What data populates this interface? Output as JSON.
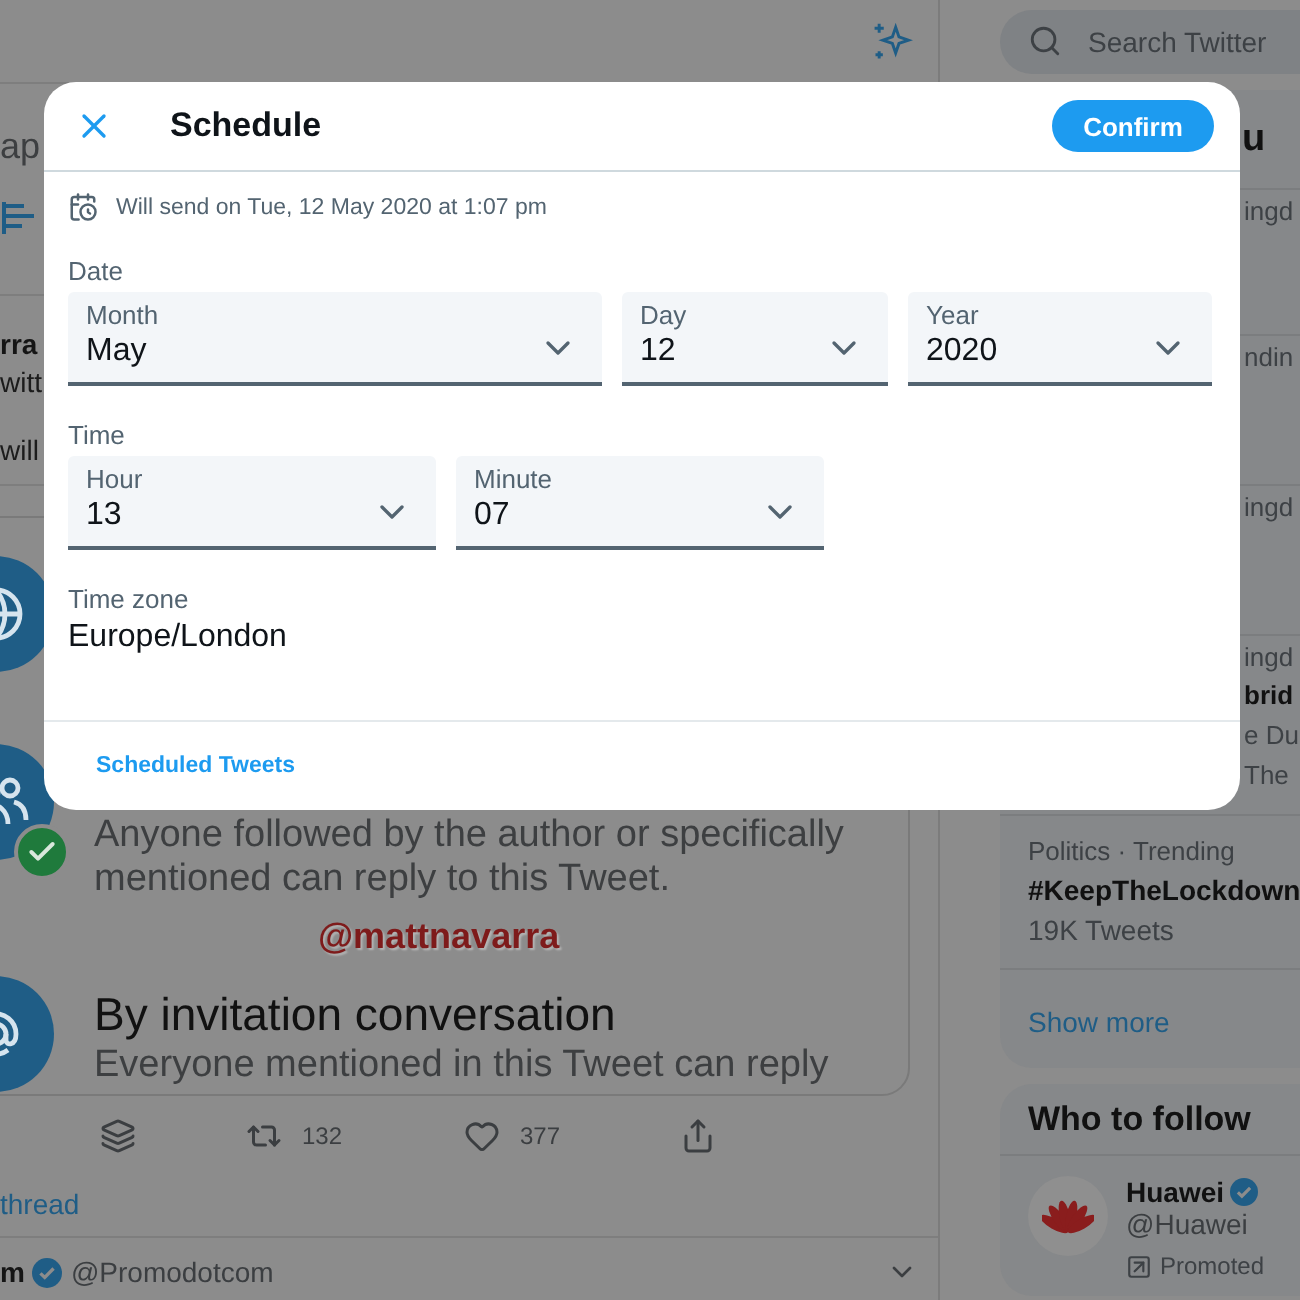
{
  "timeline": {
    "prompt_fragment": "ap",
    "tweet": {
      "author_fragment": "rra",
      "text_fragments": [
        "witt",
        "will"
      ],
      "image": {
        "options": [
          {
            "lines": [
              "Anyone followed by the author or specifically",
              "mentioned can reply to this Tweet."
            ],
            "selected": true
          },
          {
            "title": "By invitation conversation",
            "lines": [
              "Everyone mentioned in this Tweet can reply"
            ],
            "selected": false
          }
        ],
        "credit": "@mattnavarra"
      },
      "actions": [
        {
          "kind": "layers"
        },
        {
          "kind": "retweet",
          "count": "132"
        },
        {
          "kind": "like",
          "count": "377"
        },
        {
          "kind": "share"
        }
      ],
      "thread_link": "thread"
    },
    "next_tweet": {
      "name": "m",
      "verified": true,
      "handle": "@Promodotcom"
    }
  },
  "sidebar": {
    "search": {
      "placeholder": "Search Twitter"
    },
    "trends": {
      "title": "u",
      "items": [
        {
          "kind": "partial",
          "meta": "ingd"
        },
        {
          "kind": "partial",
          "meta": "ndin"
        },
        {
          "kind": "partial",
          "meta": "ingd"
        },
        {
          "kind": "partial",
          "meta": "ingd",
          "topic": "brid",
          "lines": [
            "e Du",
            "The"
          ]
        },
        {
          "kind": "full",
          "meta": "Politics · Trending",
          "topic": "#KeepTheLockdown",
          "lines": [
            "19K Tweets"
          ]
        }
      ],
      "show_more": "Show more"
    },
    "who_to_follow": {
      "title": "Who to follow",
      "accounts": [
        {
          "name": "Huawei",
          "verified": true,
          "handle": "@Huawei",
          "promoted": "Promoted"
        }
      ]
    }
  },
  "modal": {
    "title": "Schedule",
    "confirm": "Confirm",
    "summary": "Will send on Tue, 12 May 2020 at 1:07 pm",
    "sections": [
      {
        "label": "Date",
        "selects": [
          {
            "label": "Month",
            "value": "May"
          },
          {
            "label": "Day",
            "value": "12"
          },
          {
            "label": "Year",
            "value": "2020"
          }
        ]
      },
      {
        "label": "Time",
        "selects": [
          {
            "label": "Hour",
            "value": "13"
          },
          {
            "label": "Minute",
            "value": "07"
          }
        ]
      }
    ],
    "time_zone": {
      "label": "Time zone",
      "value": "Europe/London"
    },
    "footer_link": "Scheduled Tweets"
  }
}
